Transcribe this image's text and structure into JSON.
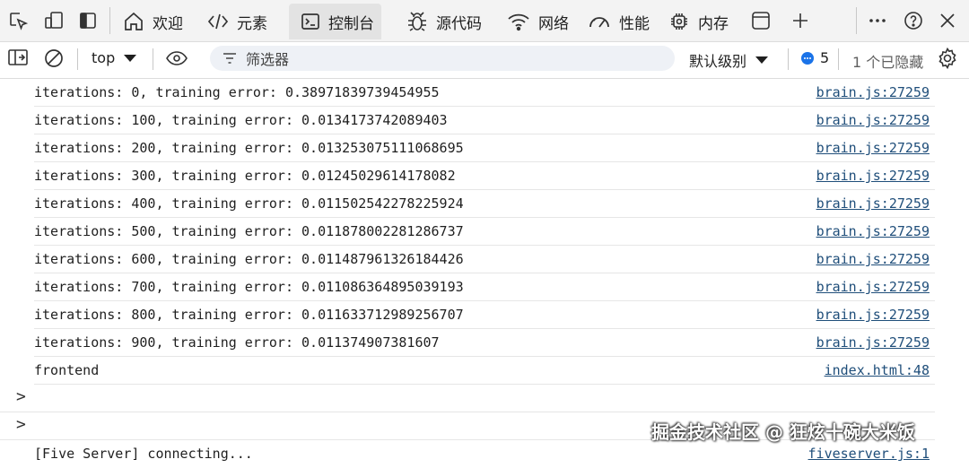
{
  "tabs": [
    {
      "label": "欢迎",
      "icon": "home-icon"
    },
    {
      "label": "元素",
      "icon": "code-icon"
    },
    {
      "label": "控制台",
      "icon": "console-icon"
    },
    {
      "label": "源代码",
      "icon": "bug-icon"
    },
    {
      "label": "网络",
      "icon": "wifi-icon"
    },
    {
      "label": "性能",
      "icon": "gauge-icon"
    },
    {
      "label": "内存",
      "icon": "chip-icon"
    }
  ],
  "toolbar": {
    "context": "top",
    "filter_placeholder": "筛选器",
    "level": "默认级别",
    "message_count": "5",
    "hidden": "1 个已隐藏"
  },
  "log": [
    {
      "msg": "iterations: 0, training error: 0.38971839739454955",
      "src": "brain.js:27259"
    },
    {
      "msg": "iterations: 100, training error: 0.0134173742089403",
      "src": "brain.js:27259"
    },
    {
      "msg": "iterations: 200, training error: 0.013253075111068695",
      "src": "brain.js:27259"
    },
    {
      "msg": "iterations: 300, training error: 0.01245029614178082",
      "src": "brain.js:27259"
    },
    {
      "msg": "iterations: 400, training error: 0.011502542278225924",
      "src": "brain.js:27259"
    },
    {
      "msg": "iterations: 500, training error: 0.011878002281286737",
      "src": "brain.js:27259"
    },
    {
      "msg": "iterations: 600, training error: 0.011487961326184426",
      "src": "brain.js:27259"
    },
    {
      "msg": "iterations: 700, training error: 0.011086364895039193",
      "src": "brain.js:27259"
    },
    {
      "msg": "iterations: 800, training error: 0.011633712989256707",
      "src": "brain.js:27259"
    },
    {
      "msg": "iterations: 900, training error: 0.011374907381607",
      "src": "brain.js:27259"
    },
    {
      "msg": "frontend",
      "src": "index.html:48"
    }
  ],
  "prompts": [
    ">",
    ">"
  ],
  "last": {
    "msg": "[Five Server] connecting...",
    "src": "fiveserver.js:1"
  },
  "watermark": "掘金技术社区 @ 狂炫十碗大米饭",
  "colors": {
    "link": "#1f4e7a",
    "badge": "#1a73e8",
    "active_tab": "#e3e3e3"
  }
}
